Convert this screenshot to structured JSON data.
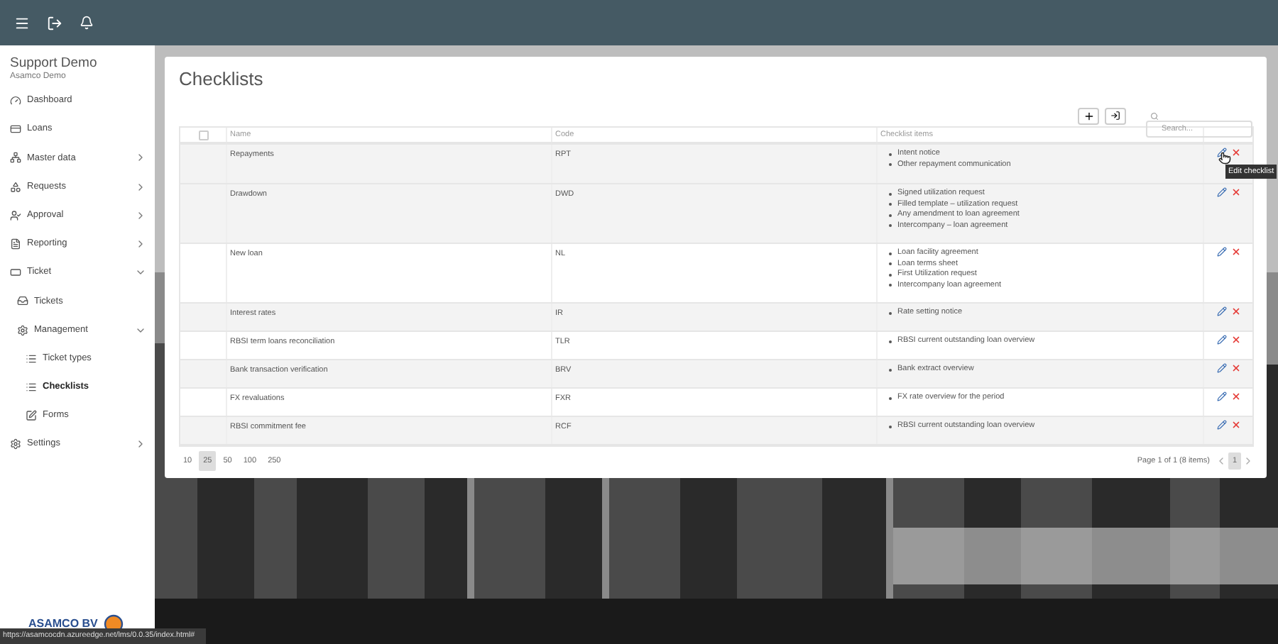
{
  "sidebar": {
    "title": "Support Demo",
    "subtitle": "Asamco Demo",
    "items": [
      {
        "label": "Dashboard",
        "selected": false
      },
      {
        "label": "Loans",
        "selected": false
      },
      {
        "label": "Master data",
        "selected": false,
        "expanded": false
      },
      {
        "label": "Requests",
        "selected": false,
        "expanded": false
      },
      {
        "label": "Approval",
        "selected": false,
        "expanded": false
      },
      {
        "label": "Reporting",
        "selected": false,
        "expanded": false
      },
      {
        "label": "Ticket",
        "selected": false,
        "expanded": true,
        "children": [
          {
            "label": "Tickets",
            "selected": false
          },
          {
            "label": "Management",
            "selected": false,
            "expanded": true,
            "children": [
              {
                "label": "Ticket types",
                "selected": false
              },
              {
                "label": "Checklists",
                "selected": true
              },
              {
                "label": "Forms",
                "selected": false
              }
            ]
          }
        ]
      },
      {
        "label": "Settings",
        "selected": false,
        "expanded": false
      }
    ],
    "logo": "ASAMCO BV"
  },
  "page": {
    "title": "Checklists",
    "search": {
      "placeholder": "Search..."
    }
  },
  "table": {
    "select_all": {
      "checked": false
    },
    "columns": [
      "Name",
      "Code",
      "Checklist items"
    ],
    "rows": [
      {
        "name": "Repayments",
        "code": "RPT",
        "items": [
          "Intent notice",
          "Other repayment communication"
        ],
        "hovered": true
      },
      {
        "name": "Drawdown",
        "code": "DWD",
        "items": [
          "Signed utilization request",
          "Filled template – utilization request",
          "Any amendment to loan agreement",
          "Intercompany – loan agreement"
        ],
        "hovered": false
      },
      {
        "name": "New loan",
        "code": "NL",
        "items": [
          "Loan facility agreement",
          "Loan terms sheet",
          "First Utilization request",
          "Intercompany loan agreement"
        ],
        "hovered": false
      },
      {
        "name": "Interest rates",
        "code": "IR",
        "items": [
          "Rate setting notice"
        ],
        "hovered": false
      },
      {
        "name": "RBSI term loans reconciliation",
        "code": "TLR",
        "items": [
          "RBSI current outstanding loan overview"
        ],
        "hovered": false
      },
      {
        "name": "Bank transaction verification",
        "code": "BRV",
        "items": [
          "Bank extract overview"
        ],
        "hovered": false
      },
      {
        "name": "FX revaluations",
        "code": "FXR",
        "items": [
          "FX rate overview for the period"
        ],
        "hovered": false
      },
      {
        "name": "RBSI commitment fee",
        "code": "RCF",
        "items": [
          "RBSI current outstanding loan overview"
        ],
        "hovered": false
      }
    ],
    "tooltip": "Edit checklist"
  },
  "pager": {
    "sizes": [
      {
        "label": "10",
        "selected": false
      },
      {
        "label": "25",
        "selected": true
      },
      {
        "label": "50",
        "selected": false
      },
      {
        "label": "100",
        "selected": false
      },
      {
        "label": "250",
        "selected": false
      }
    ],
    "info": "Page 1 of 1 (8 items)",
    "pages": [
      {
        "label": "1",
        "selected": true
      }
    ]
  },
  "status_bar": {
    "url": "https://asamcocdn.azureedge.net/lms/0.0.35/index.html#"
  }
}
